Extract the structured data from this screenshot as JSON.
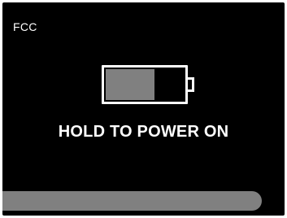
{
  "screen": {
    "corner_label": "FCC",
    "prompt": "HOLD TO POWER ON"
  },
  "battery": {
    "icon": "battery-icon",
    "charge_fraction": 0.63,
    "fill_color": "#808080",
    "outline_color": "#ffffff"
  },
  "hold_progress": {
    "fraction": 1.0,
    "color": "#808080"
  },
  "colors": {
    "background": "#000000",
    "text": "#ffffff"
  }
}
